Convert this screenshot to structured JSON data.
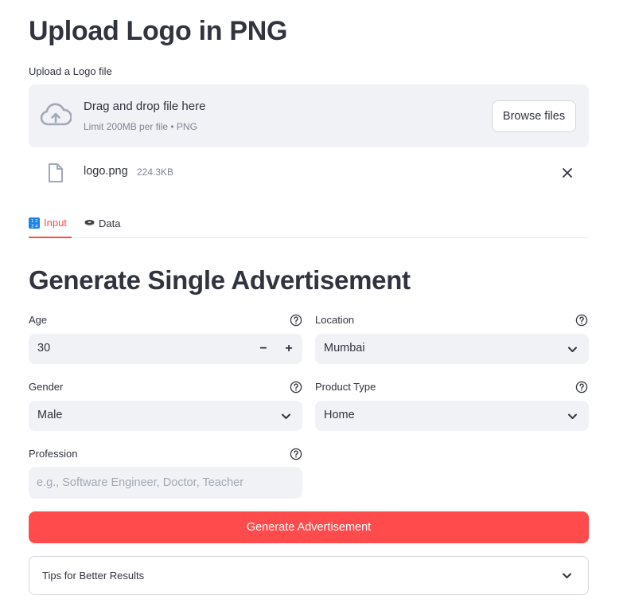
{
  "header": {
    "title": "Upload Logo in PNG"
  },
  "uploader": {
    "label": "Upload a Logo file",
    "drag_text": "Drag and drop file here",
    "limit_text": "Limit 200MB per file • PNG",
    "browse_label": "Browse files",
    "icon": "cloud-upload-icon"
  },
  "uploaded_file": {
    "name": "logo.png",
    "size": "224.3KB",
    "icon": "file-icon"
  },
  "tabs": [
    {
      "label": "Input",
      "icon": "input-numbers-icon",
      "active": true
    },
    {
      "label": "Data",
      "icon": "disk-icon",
      "active": false
    }
  ],
  "form": {
    "title": "Generate Single Advertisement",
    "age": {
      "label": "Age",
      "value": "30",
      "minus": "−",
      "plus": "+"
    },
    "location": {
      "label": "Location",
      "value": "Mumbai"
    },
    "gender": {
      "label": "Gender",
      "value": "Male"
    },
    "product_type": {
      "label": "Product Type",
      "value": "Home"
    },
    "profession": {
      "label": "Profession",
      "value": "",
      "placeholder": "e.g., Software Engineer, Doctor, Teacher"
    },
    "submit_label": "Generate Advertisement"
  },
  "expander": {
    "label": "Tips for Better Results"
  },
  "colors": {
    "accent": "#ff4b4b",
    "field_bg": "#f0f2f6",
    "text": "#31333f",
    "muted": "#808495"
  }
}
